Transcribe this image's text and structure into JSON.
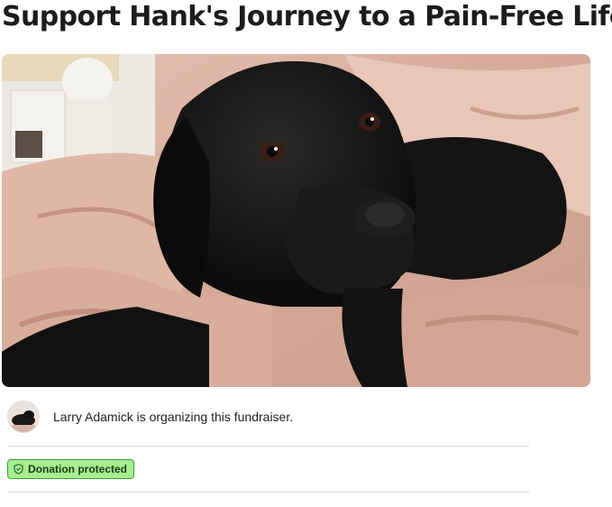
{
  "page": {
    "title": "Support Hank's Journey to a Pain-Free Life"
  },
  "hero": {
    "image_name": "black-labrador-on-pink-comforter"
  },
  "organizer": {
    "text": "Larry Adamick is organizing this fundraiser.",
    "avatar_icon": "dog-avatar"
  },
  "badge": {
    "label": "Donation protected",
    "icon": "shield-icon",
    "bg_color": "#a7ef8f",
    "border_color": "#3e9b3a"
  }
}
